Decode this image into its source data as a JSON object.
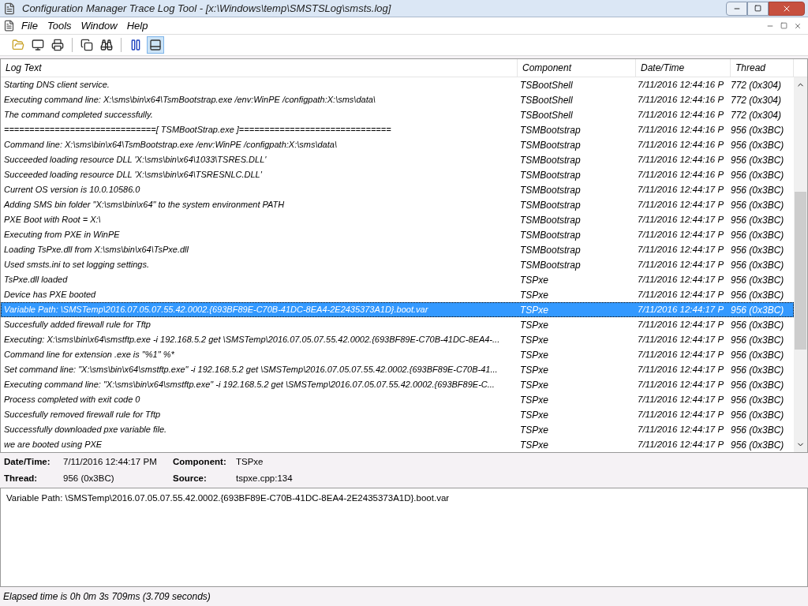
{
  "window": {
    "title": "Configuration Manager Trace Log Tool - [x:\\Windows\\temp\\SMSTSLog\\smsts.log]"
  },
  "menu": [
    "File",
    "Tools",
    "Window",
    "Help"
  ],
  "toolbar": [
    {
      "kind": "open",
      "pressed": false
    },
    {
      "kind": "computer",
      "pressed": false
    },
    {
      "kind": "print",
      "pressed": false
    },
    {
      "kind": "separator"
    },
    {
      "kind": "copy",
      "pressed": false
    },
    {
      "kind": "find",
      "pressed": false
    },
    {
      "kind": "separator"
    },
    {
      "kind": "pause",
      "pressed": false
    },
    {
      "kind": "details",
      "pressed": true
    }
  ],
  "table": {
    "columns": [
      "Log Text",
      "Component",
      "Date/Time",
      "Thread"
    ],
    "rows": [
      {
        "text": "Starting DNS client service.",
        "component": "TSBootShell",
        "datetime": "7/11/2016 12:44:16 P",
        "thread": "772 (0x304)",
        "selected": false
      },
      {
        "text": "Executing command line: X:\\sms\\bin\\x64\\TsmBootstrap.exe /env:WinPE /configpath:X:\\sms\\data\\",
        "component": "TSBootShell",
        "datetime": "7/11/2016 12:44:16 P",
        "thread": "772 (0x304)",
        "selected": false
      },
      {
        "text": "The command completed successfully.",
        "component": "TSBootShell",
        "datetime": "7/11/2016 12:44:16 P",
        "thread": "772 (0x304)",
        "selected": false
      },
      {
        "text": "==============================[ TSMBootStrap.exe ]==============================",
        "component": "TSMBootstrap",
        "datetime": "7/11/2016 12:44:16 P",
        "thread": "956 (0x3BC)",
        "selected": false
      },
      {
        "text": "Command line: X:\\sms\\bin\\x64\\TsmBootstrap.exe /env:WinPE /configpath:X:\\sms\\data\\",
        "component": "TSMBootstrap",
        "datetime": "7/11/2016 12:44:16 P",
        "thread": "956 (0x3BC)",
        "selected": false
      },
      {
        "text": "Succeeded loading resource DLL 'X:\\sms\\bin\\x64\\1033\\TSRES.DLL'",
        "component": "TSMBootstrap",
        "datetime": "7/11/2016 12:44:16 P",
        "thread": "956 (0x3BC)",
        "selected": false
      },
      {
        "text": "Succeeded loading resource DLL 'X:\\sms\\bin\\x64\\TSRESNLC.DLL'",
        "component": "TSMBootstrap",
        "datetime": "7/11/2016 12:44:16 P",
        "thread": "956 (0x3BC)",
        "selected": false
      },
      {
        "text": "Current OS version is 10.0.10586.0",
        "component": "TSMBootstrap",
        "datetime": "7/11/2016 12:44:17 P",
        "thread": "956 (0x3BC)",
        "selected": false
      },
      {
        "text": "Adding SMS bin folder \"X:\\sms\\bin\\x64\" to the system environment PATH",
        "component": "TSMBootstrap",
        "datetime": "7/11/2016 12:44:17 P",
        "thread": "956 (0x3BC)",
        "selected": false
      },
      {
        "text": "PXE Boot with Root = X:\\",
        "component": "TSMBootstrap",
        "datetime": "7/11/2016 12:44:17 P",
        "thread": "956 (0x3BC)",
        "selected": false
      },
      {
        "text": "Executing from PXE in WinPE",
        "component": "TSMBootstrap",
        "datetime": "7/11/2016 12:44:17 P",
        "thread": "956 (0x3BC)",
        "selected": false
      },
      {
        "text": "Loading TsPxe.dll from X:\\sms\\bin\\x64\\TsPxe.dll",
        "component": "TSMBootstrap",
        "datetime": "7/11/2016 12:44:17 P",
        "thread": "956 (0x3BC)",
        "selected": false
      },
      {
        "text": "Used smsts.ini to set logging settings.",
        "component": "TSMBootstrap",
        "datetime": "7/11/2016 12:44:17 P",
        "thread": "956 (0x3BC)",
        "selected": false
      },
      {
        "text": "TsPxe.dll loaded",
        "component": "TSPxe",
        "datetime": "7/11/2016 12:44:17 P",
        "thread": "956 (0x3BC)",
        "selected": false
      },
      {
        "text": "Device has PXE booted",
        "component": "TSPxe",
        "datetime": "7/11/2016 12:44:17 P",
        "thread": "956 (0x3BC)",
        "selected": false
      },
      {
        "text": "Variable Path: \\SMSTemp\\2016.07.05.07.55.42.0002.{693BF89E-C70B-41DC-8EA4-2E2435373A1D}.boot.var",
        "component": "TSPxe",
        "datetime": "7/11/2016 12:44:17 P",
        "thread": "956 (0x3BC)",
        "selected": true
      },
      {
        "text": "Succesfully added firewall rule for Tftp",
        "component": "TSPxe",
        "datetime": "7/11/2016 12:44:17 P",
        "thread": "956 (0x3BC)",
        "selected": false
      },
      {
        "text": "Executing: X:\\sms\\bin\\x64\\smstftp.exe -i 192.168.5.2 get \\SMSTemp\\2016.07.05.07.55.42.0002.{693BF89E-C70B-41DC-8EA4-...",
        "component": "TSPxe",
        "datetime": "7/11/2016 12:44:17 P",
        "thread": "956 (0x3BC)",
        "selected": false
      },
      {
        "text": "Command line for extension .exe is \"%1\" %*",
        "component": "TSPxe",
        "datetime": "7/11/2016 12:44:17 P",
        "thread": "956 (0x3BC)",
        "selected": false
      },
      {
        "text": "Set command line: \"X:\\sms\\bin\\x64\\smstftp.exe\" -i 192.168.5.2 get \\SMSTemp\\2016.07.05.07.55.42.0002.{693BF89E-C70B-41...",
        "component": "TSPxe",
        "datetime": "7/11/2016 12:44:17 P",
        "thread": "956 (0x3BC)",
        "selected": false
      },
      {
        "text": "Executing command line: \"X:\\sms\\bin\\x64\\smstftp.exe\" -i 192.168.5.2 get \\SMSTemp\\2016.07.05.07.55.42.0002.{693BF89E-C...",
        "component": "TSPxe",
        "datetime": "7/11/2016 12:44:17 P",
        "thread": "956 (0x3BC)",
        "selected": false
      },
      {
        "text": "Process completed with exit code 0",
        "component": "TSPxe",
        "datetime": "7/11/2016 12:44:17 P",
        "thread": "956 (0x3BC)",
        "selected": false
      },
      {
        "text": "Succesfully removed firewall rule for Tftp",
        "component": "TSPxe",
        "datetime": "7/11/2016 12:44:17 P",
        "thread": "956 (0x3BC)",
        "selected": false
      },
      {
        "text": "Successfully downloaded pxe variable file.",
        "component": "TSPxe",
        "datetime": "7/11/2016 12:44:17 P",
        "thread": "956 (0x3BC)",
        "selected": false
      },
      {
        "text": "we are booted using PXE",
        "component": "TSPxe",
        "datetime": "7/11/2016 12:44:17 P",
        "thread": "956 (0x3BC)",
        "selected": false
      }
    ]
  },
  "details": [
    {
      "label": "Date/Time:",
      "value": "7/11/2016 12:44:17 PM"
    },
    {
      "label": "Component:",
      "value": "TSPxe"
    },
    {
      "label": "Thread:",
      "value": "956 (0x3BC)"
    },
    {
      "label": "Source:",
      "value": "tspxe.cpp:134"
    }
  ],
  "message": "Variable Path: \\SMSTemp\\2016.07.05.07.55.42.0002.{693BF89E-C70B-41DC-8EA4-2E2435373A1D}.boot.var",
  "status_bar": "Elapsed time is 0h 0m 3s 709ms (3.709 seconds)"
}
